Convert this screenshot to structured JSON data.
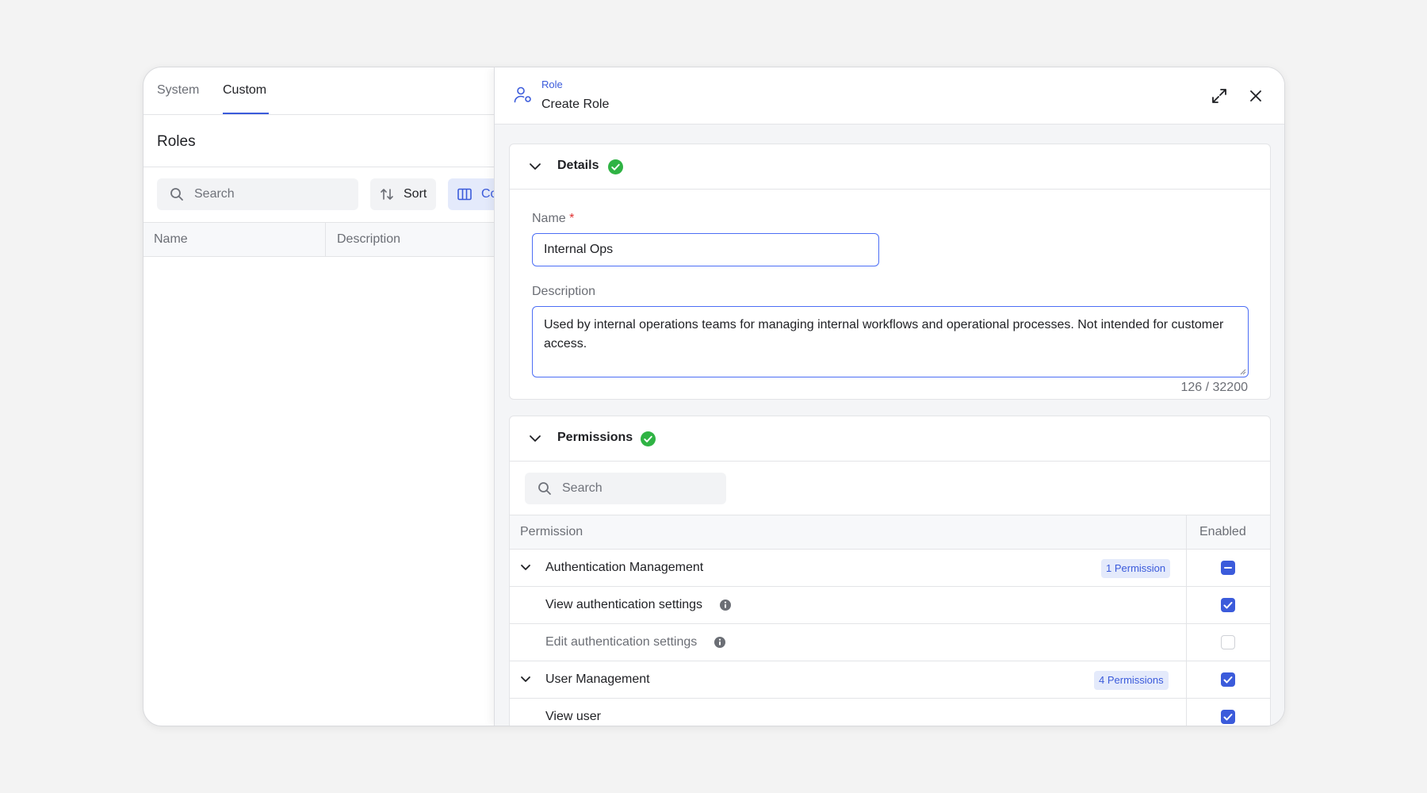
{
  "left": {
    "tabs": [
      {
        "label": "System",
        "active": false
      },
      {
        "label": "Custom",
        "active": true
      }
    ],
    "title": "Roles",
    "search_placeholder": "Search",
    "sort_label": "Sort",
    "columns_label": "Co",
    "table_headers": [
      "Name",
      "Description"
    ]
  },
  "panel": {
    "eyebrow": "Role",
    "title": "Create Role",
    "details": {
      "title": "Details",
      "name_label": "Name",
      "required_mark": "*",
      "name_value": "Internal Ops",
      "description_label": "Description",
      "description_value": "Used by internal operations teams for managing internal workflows and operational processes. Not intended for customer access.",
      "counter": "126 / 32200"
    },
    "permissions": {
      "title": "Permissions",
      "search_placeholder": "Search",
      "headers": [
        "Permission",
        "Enabled"
      ],
      "rows": [
        {
          "label": "Authentication Management",
          "badge": "1 Permission",
          "state": "indeterminate",
          "group": true
        },
        {
          "label": "View authentication settings",
          "state": "checked",
          "info": true
        },
        {
          "label": "Edit authentication settings",
          "state": "unchecked",
          "info": true
        },
        {
          "label": "User Management",
          "badge": "4 Permissions",
          "state": "checked",
          "group": true
        },
        {
          "label": "View user",
          "state": "checked"
        }
      ]
    }
  },
  "colors": {
    "accent": "#3b5bdb",
    "success": "#2fb344",
    "background": "#f3f3f3"
  },
  "icons": [
    "search-icon",
    "sort-icon",
    "columns-icon",
    "role-icon",
    "expand-icon",
    "close-icon",
    "chevron-down-icon",
    "check-circle-icon",
    "info-icon"
  ]
}
